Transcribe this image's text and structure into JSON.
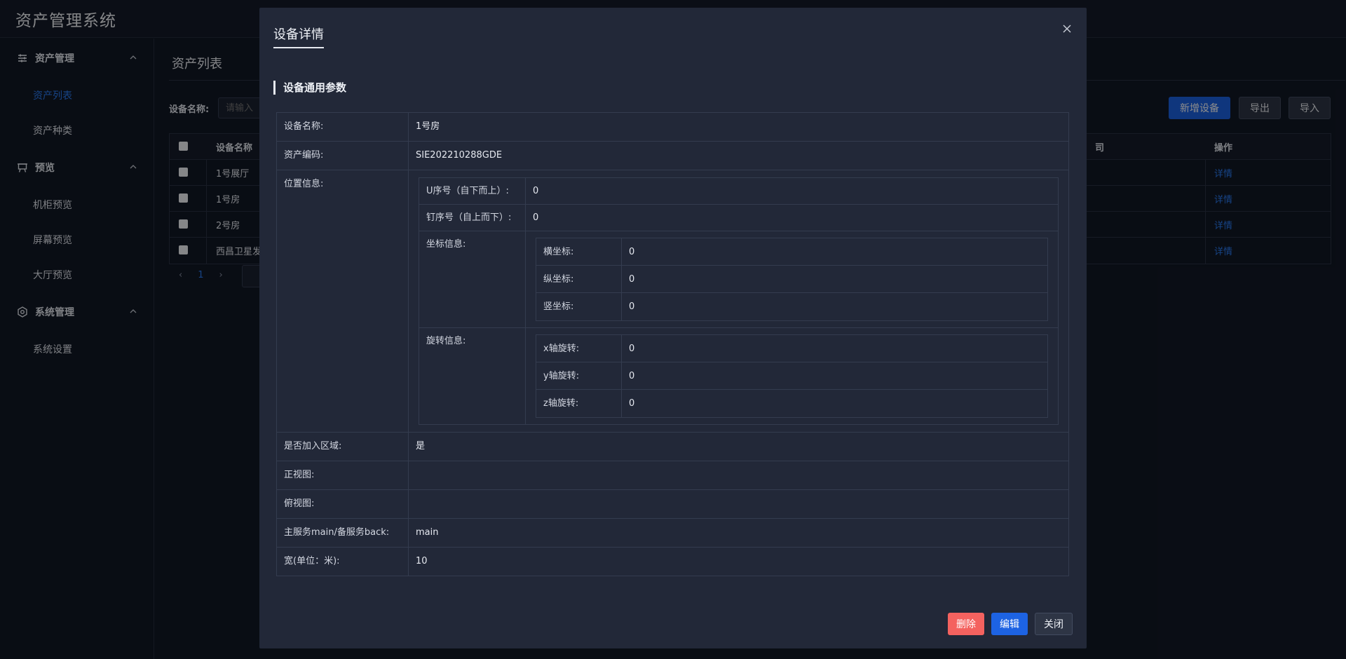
{
  "app": {
    "title": "资产管理系统"
  },
  "sidebar": {
    "groups": [
      {
        "label": "资产管理",
        "items": [
          {
            "label": "资产列表"
          },
          {
            "label": "资产种类"
          }
        ]
      },
      {
        "label": "预览",
        "items": [
          {
            "label": "机柜预览"
          },
          {
            "label": "屏幕预览"
          },
          {
            "label": "大厅预览"
          }
        ]
      },
      {
        "label": "系统管理",
        "items": [
          {
            "label": "系统设置"
          }
        ]
      }
    ]
  },
  "page": {
    "title": "资产列表",
    "filter": {
      "label": "设备名称:",
      "placeholder": "请输入"
    },
    "buttons": {
      "new": "新增设备",
      "export": "导出",
      "import": "导入"
    },
    "table": {
      "columns": {
        "name": "设备名称",
        "company": "司",
        "op": "操作"
      },
      "rows": [
        {
          "name": "1号展厅",
          "op": "详情"
        },
        {
          "name": "1号房",
          "op": "详情"
        },
        {
          "name": "2号房",
          "op": "详情"
        },
        {
          "name": "西昌卫星发",
          "op": "详情"
        }
      ]
    },
    "pagination": {
      "current": "1",
      "prev": "‹",
      "next": "›"
    }
  },
  "modal": {
    "title": "设备详情",
    "section": "设备通用参数",
    "fields": {
      "name": {
        "label": "设备名称:",
        "value": "1号房"
      },
      "code": {
        "label": "资产编码:",
        "value": "SIE202210288GDE"
      },
      "position": {
        "label": "位置信息:",
        "u": {
          "label": "U序号（自下而上）:",
          "value": "0"
        },
        "nail": {
          "label": "钉序号（自上而下）:",
          "value": "0"
        },
        "coords": {
          "label": "坐标信息:",
          "x": {
            "label": "横坐标:",
            "value": "0"
          },
          "y": {
            "label": "纵坐标:",
            "value": "0"
          },
          "z": {
            "label": "竖坐标:",
            "value": "0"
          }
        },
        "rotation": {
          "label": "旋转信息:",
          "x": {
            "label": "x轴旋转:",
            "value": "0"
          },
          "y": {
            "label": "y轴旋转:",
            "value": "0"
          },
          "z": {
            "label": "z轴旋转:",
            "value": "0"
          }
        }
      },
      "region": {
        "label": "是否加入区域:",
        "value": "是"
      },
      "front": {
        "label": "正视图:",
        "value": ""
      },
      "top": {
        "label": "俯视图:",
        "value": ""
      },
      "service": {
        "label": "主服务main/备服务back:",
        "value": "main"
      },
      "width": {
        "label": "宽(单位：米):",
        "value": "10"
      }
    },
    "buttons": {
      "delete": "删除",
      "edit": "编辑",
      "close": "关闭"
    }
  },
  "colors": {
    "accent": "#1d63e3",
    "link": "#2a7cf5",
    "danger": "#f4625f",
    "background": "#121826"
  }
}
